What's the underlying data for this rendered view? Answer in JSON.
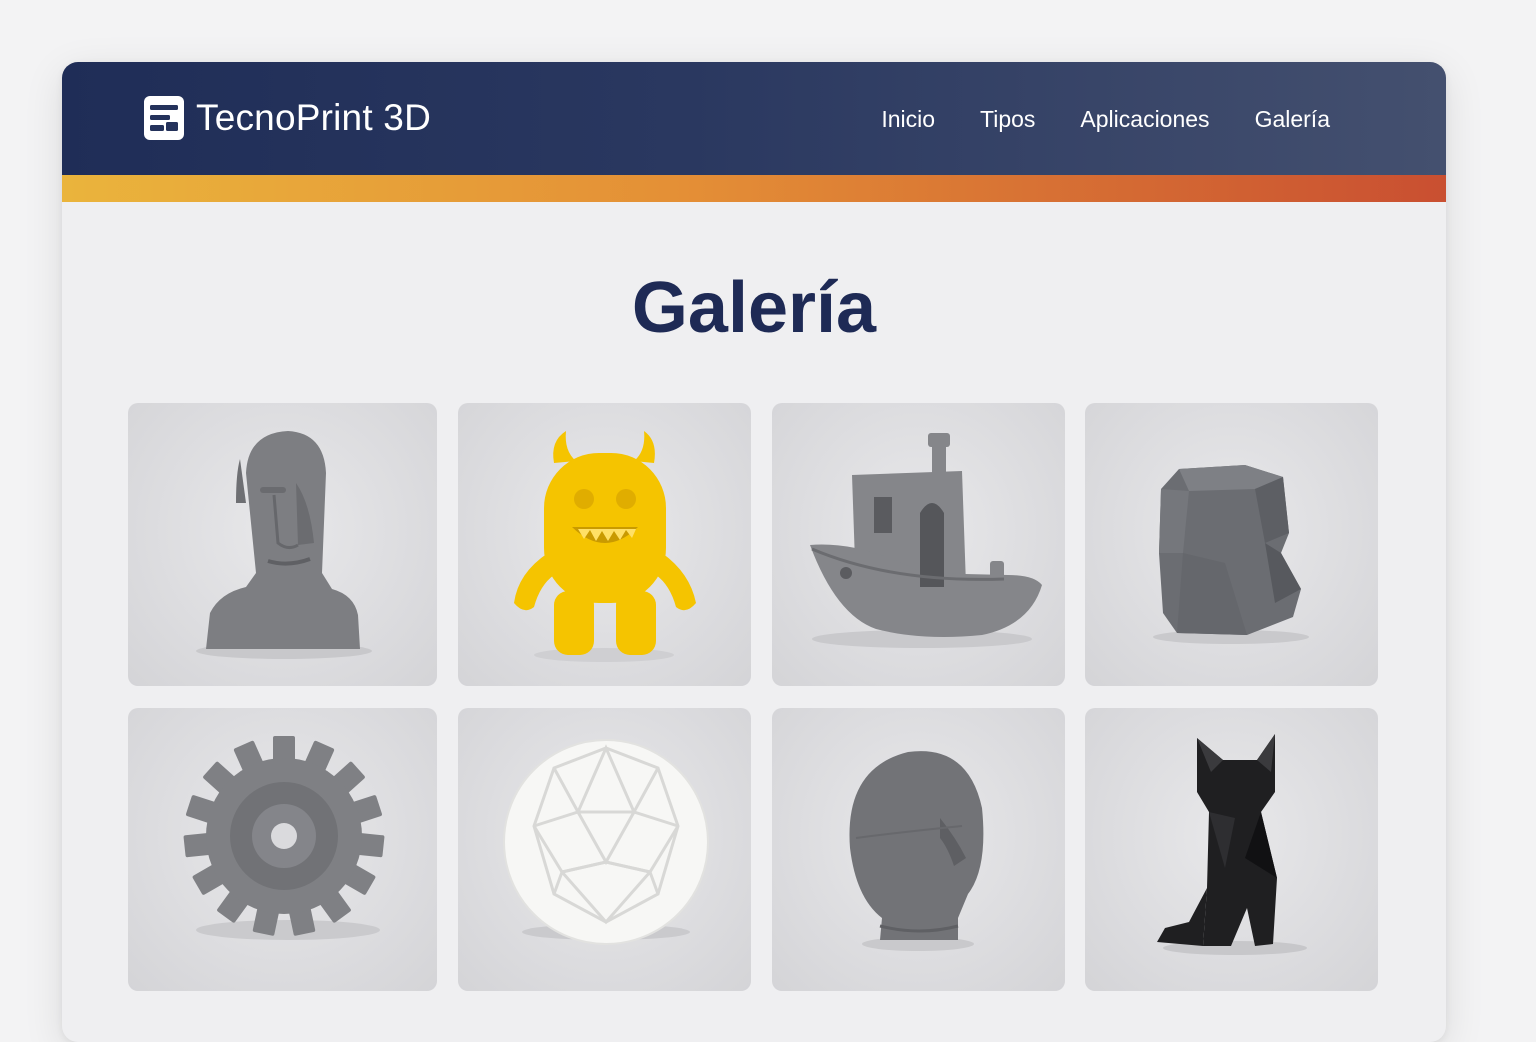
{
  "brand": {
    "name": "TecnoPrint 3D",
    "logo_icon": "layered-square-logo-icon"
  },
  "nav": {
    "items": [
      {
        "label": "Inicio"
      },
      {
        "label": "Tipos"
      },
      {
        "label": "Aplicaciones"
      },
      {
        "label": "Galería"
      }
    ]
  },
  "gallery": {
    "title": "Galería",
    "items": [
      {
        "subject": "moai-head",
        "color": "#7d7e82"
      },
      {
        "subject": "yellow-monster",
        "color": "#f5c400"
      },
      {
        "subject": "benchy-boat",
        "color": "#85868a"
      },
      {
        "subject": "low-poly-rock",
        "color": "#6b6d72"
      },
      {
        "subject": "gear",
        "color": "#7f8084"
      },
      {
        "subject": "geodesic-sphere",
        "color": "#f7f7f5"
      },
      {
        "subject": "abstract-head",
        "color": "#727377"
      },
      {
        "subject": "low-poly-cat",
        "color": "#1f1f21"
      }
    ]
  },
  "colors": {
    "header": "#1f2d57",
    "accent_start": "#eab43c",
    "accent_end": "#c94f31",
    "title": "#1e2a55"
  }
}
